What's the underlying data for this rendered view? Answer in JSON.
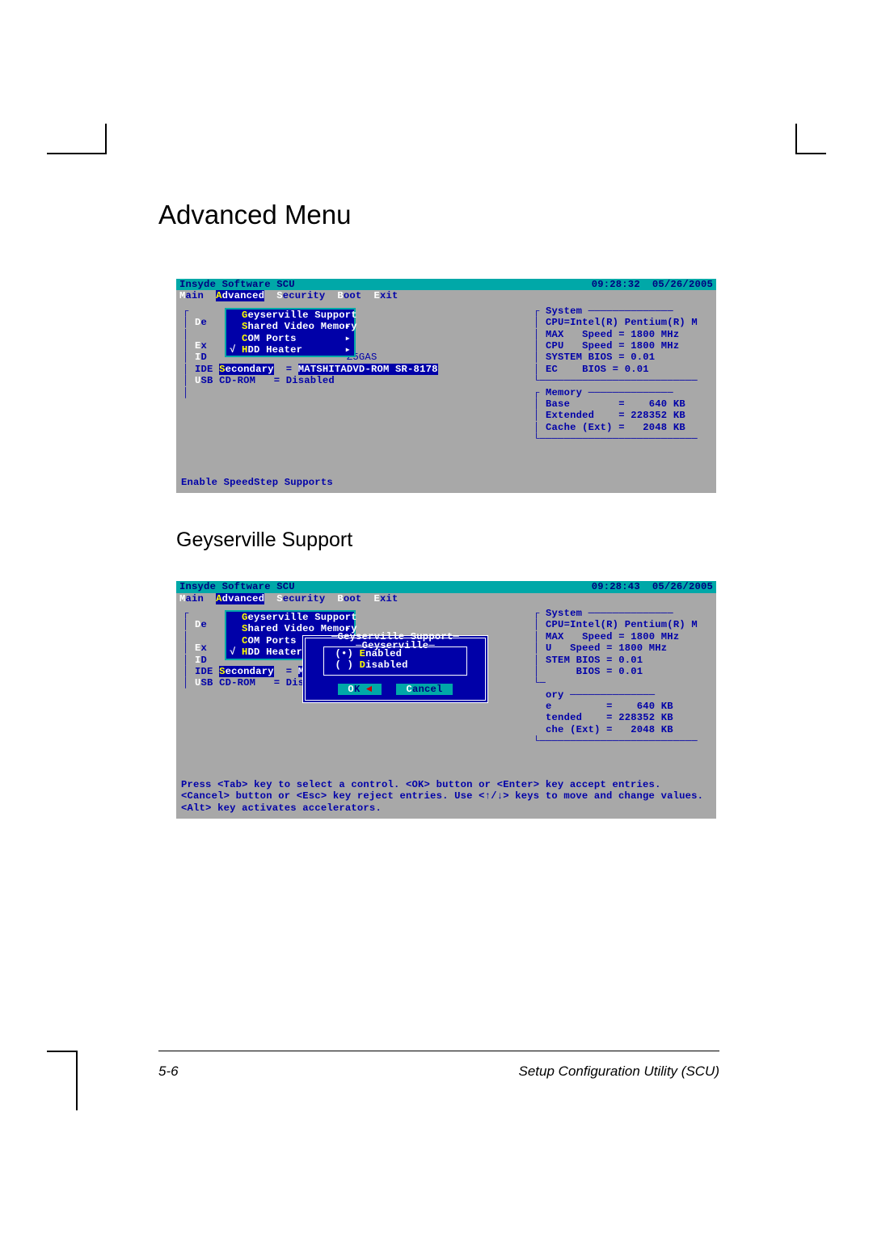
{
  "headings": {
    "h1": "Advanced Menu",
    "h2": "Geyserville Support"
  },
  "bios_title": "Insyde Software SCU",
  "menu": {
    "main": "Main",
    "main_hot": "M",
    "advanced": "Advanced",
    "advanced_hot": "A",
    "security": "Security",
    "security_hot": "S",
    "boot": "Boot",
    "boot_hot": "B",
    "exit": "Exit",
    "exit_hot": "E"
  },
  "dropdown": {
    "geyserville": "Geyserville Support",
    "geyserville_hot": "G",
    "shared": "Shared Video Memory",
    "shared_hot": "S",
    "com": "COM Ports",
    "com_hot": "C",
    "hdd": "HDD Heater",
    "hdd_hot": "H",
    "arrow": "▸",
    "check": "√"
  },
  "left_panel": {
    "de": "De",
    "de_hot": "D",
    "ex": "Ex",
    "ex_hot": "E",
    "id": "ID",
    "id_hot": "I",
    "z5gas": "Z5GAS",
    "ide_sec": "IDE Secondary",
    "ide_sec_hot": "S",
    "ide_val": "MATSHITADVD-ROM SR-8178",
    "ide_val_short": "MAT",
    "usb": "USB CD-ROM",
    "usb_hot": "U",
    "usb_val": "Disabled",
    "usb_val_short": "Disabl"
  },
  "system_box": {
    "title": "System",
    "cpu": "CPU=Intel(R) Pentium(R) M",
    "max": "MAX   Speed = 1800 MHz",
    "cpuspd": "CPU   Speed = 1800 MHz",
    "sysbios": "SYSTEM BIOS = 0.01",
    "ec": "EC    BIOS = 0.01",
    "u": "U",
    "stem": "STEM BIOS = 0.01",
    "bios2": "     BIOS = 0.01"
  },
  "memory_box": {
    "title": "Memory",
    "base": "Base        =    640 KB",
    "extended": "Extended    = 228352 KB",
    "cache": "Cache (Ext) =   2048 KB",
    "p_title": "ory",
    "p_base": "e         =    640 KB",
    "p_ext": "tended    = 228352 KB",
    "p_cache": "che (Ext) =   2048 KB"
  },
  "help1": "Enable SpeedStep Supports",
  "help2": "Press <Tab> key to select a control. <OK> button or <Enter> key accept entries. <Cancel> button or <Esc> key reject entries. Use <↑/↓> keys to move and change values. <Alt> key activates accelerators.",
  "dialog": {
    "title": "Geyserville Support",
    "inner_title": "Geyserville",
    "enabled": "Enabled",
    "enabled_hot": "E",
    "disabled": "Disabled",
    "disabled_hot": "D",
    "dot": "(•)",
    "blank": "( )",
    "ok": "OK",
    "ok_hot": "O",
    "cancel": "Cancel",
    "cancel_hot": "C",
    "tri": "◄"
  },
  "times": {
    "s1": "09:28:32  05/26/2005",
    "s2": "09:28:43  05/26/2005"
  },
  "footer": {
    "page": "5-6",
    "title": "Setup Configuration Utility (SCU)"
  }
}
